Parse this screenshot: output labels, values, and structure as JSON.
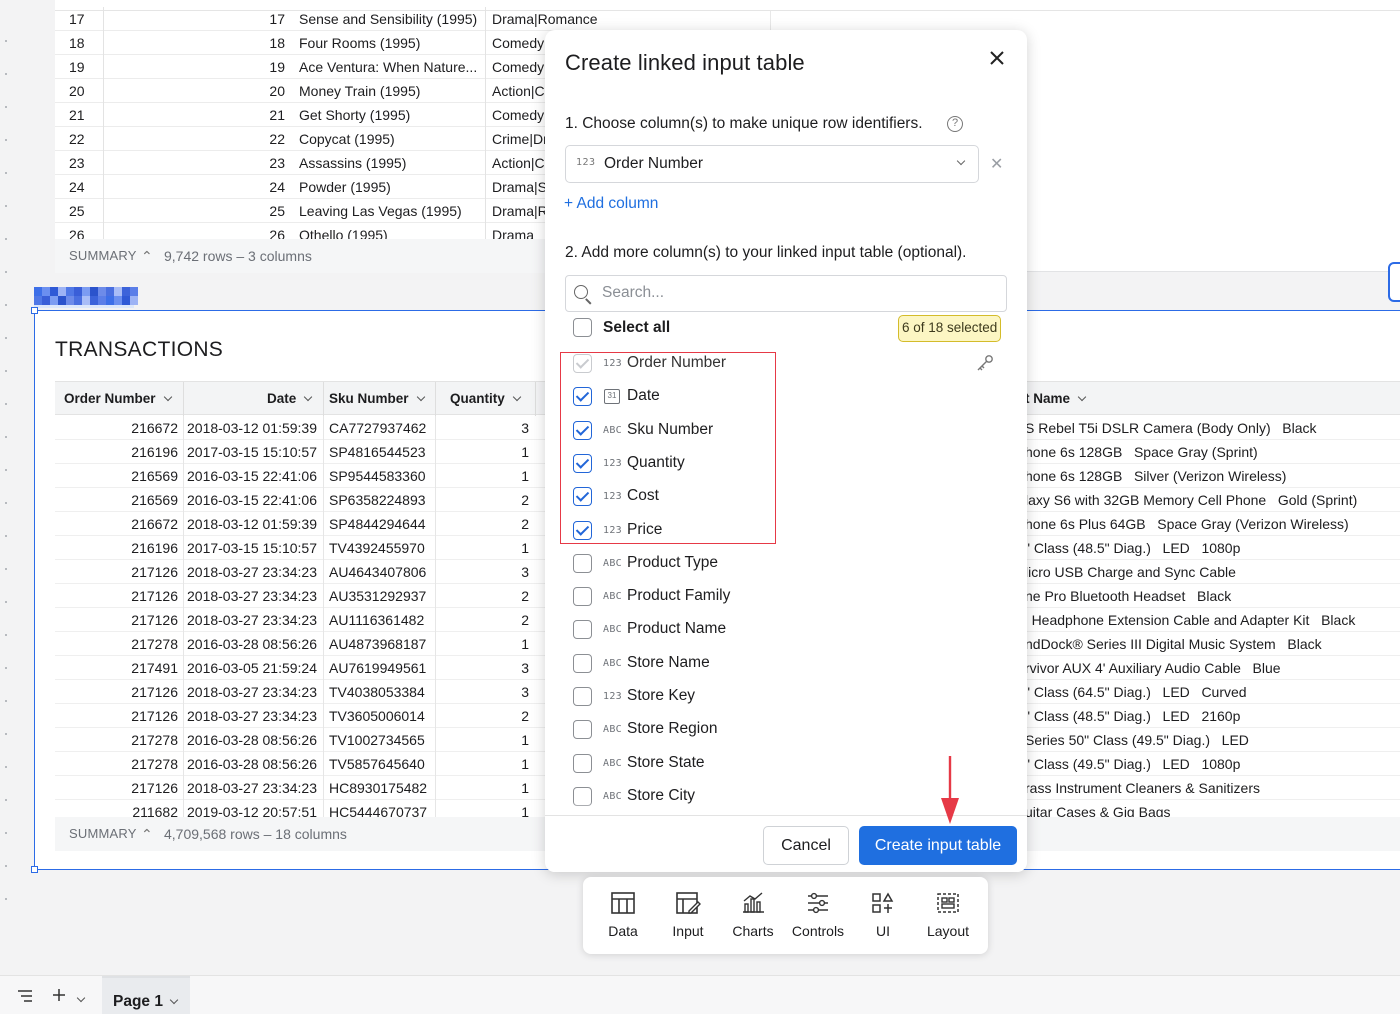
{
  "movies": {
    "rows": [
      {
        "idx": "17",
        "num": "17",
        "title": "Sense and Sensibility (1995)",
        "genre": "Drama|Romance"
      },
      {
        "idx": "18",
        "num": "18",
        "title": "Four Rooms (1995)",
        "genre": "Comedy"
      },
      {
        "idx": "19",
        "num": "19",
        "title": "Ace Ventura: When Nature...",
        "genre": "Comedy"
      },
      {
        "idx": "20",
        "num": "20",
        "title": "Money Train (1995)",
        "genre": "Action|C"
      },
      {
        "idx": "21",
        "num": "21",
        "title": "Get Shorty (1995)",
        "genre": "Comedy"
      },
      {
        "idx": "22",
        "num": "22",
        "title": "Copycat (1995)",
        "genre": "Crime|Dr"
      },
      {
        "idx": "23",
        "num": "23",
        "title": "Assassins (1995)",
        "genre": "Action|C"
      },
      {
        "idx": "24",
        "num": "24",
        "title": "Powder (1995)",
        "genre": "Drama|S"
      },
      {
        "idx": "25",
        "num": "25",
        "title": "Leaving Las Vegas (1995)",
        "genre": "Drama|R"
      },
      {
        "idx": "26",
        "num": "26",
        "title": "Othello (1995)",
        "genre": "Drama"
      }
    ],
    "summary_label": "SUMMARY",
    "summary_text": "9,742 rows – 3 columns"
  },
  "transactions": {
    "title": "TRANSACTIONS",
    "headers": {
      "order": "Order Number",
      "date": "Date",
      "sku": "Sku Number",
      "qty": "Quantity",
      "name": "t Name"
    },
    "rows": [
      {
        "order": "216672",
        "date": "2018-03-12 01:59:39",
        "sku": "CA7727937462",
        "qty": "3",
        "name": "S Rebel T5i DSLR Camera (Body Only)   Black"
      },
      {
        "order": "216196",
        "date": "2017-03-15 15:10:57",
        "sku": "SP4816544523",
        "qty": "1",
        "name": "hone 6s 128GB   Space Gray (Sprint)"
      },
      {
        "order": "216569",
        "date": "2016-03-15 22:41:06",
        "sku": "SP9544583360",
        "qty": "1",
        "name": "hone 6s 128GB   Silver (Verizon Wireless)"
      },
      {
        "order": "216569",
        "date": "2016-03-15 22:41:06",
        "sku": "SP6358224893",
        "qty": "2",
        "name": "laxy S6 with 32GB Memory Cell Phone   Gold (Sprint)"
      },
      {
        "order": "216672",
        "date": "2018-03-12 01:59:39",
        "sku": "SP4844294644",
        "qty": "2",
        "name": "hone 6s Plus 64GB   Space Gray (Verizon Wireless)"
      },
      {
        "order": "216196",
        "date": "2017-03-15 15:10:57",
        "sku": "TV4392455970",
        "qty": "1",
        "name": "\" Class (48.5\" Diag.)   LED   1080p"
      },
      {
        "order": "217126",
        "date": "2018-03-27 23:34:23",
        "sku": "AU4643407806",
        "qty": "3",
        "name": "licro USB Charge and Sync Cable"
      },
      {
        "order": "217126",
        "date": "2018-03-27 23:34:23",
        "sku": "AU3531292937",
        "qty": "2",
        "name": "ne Pro Bluetooth Headset   Black"
      },
      {
        "order": "217126",
        "date": "2018-03-27 23:34:23",
        "sku": "AU1116361482",
        "qty": "2",
        "name": "' Headphone Extension Cable and Adapter Kit   Black"
      },
      {
        "order": "217278",
        "date": "2016-03-28 08:56:26",
        "sku": "AU4873968187",
        "qty": "1",
        "name": "ndDock® Series III Digital Music System   Black"
      },
      {
        "order": "217491",
        "date": "2016-03-05 21:59:24",
        "sku": "AU7619949561",
        "qty": "3",
        "name": "rvivor AUX 4' Auxiliary Audio Cable   Blue"
      },
      {
        "order": "217126",
        "date": "2018-03-27 23:34:23",
        "sku": "TV4038053384",
        "qty": "3",
        "name": "\" Class (64.5\" Diag.)   LED   Curved"
      },
      {
        "order": "217126",
        "date": "2018-03-27 23:34:23",
        "sku": "TV3605006014",
        "qty": "2",
        "name": "\" Class (48.5\" Diag.)   LED   2160p"
      },
      {
        "order": "217278",
        "date": "2016-03-28 08:56:26",
        "sku": "TV1002734565",
        "qty": "1",
        "name": "Series 50\" Class (49.5\" Diag.)   LED"
      },
      {
        "order": "217278",
        "date": "2016-03-28 08:56:26",
        "sku": "TV5857645640",
        "qty": "1",
        "name": "\" Class (49.5\" Diag.)   LED   1080p"
      },
      {
        "order": "217126",
        "date": "2018-03-27 23:34:23",
        "sku": "HC8930175482",
        "qty": "1",
        "name": "rass Instrument Cleaners & Sanitizers"
      },
      {
        "order": "211682",
        "date": "2019-03-12 20:57:51",
        "sku": "HC5444670737",
        "qty": "1",
        "name": "uitar Cases & Gig Bags"
      }
    ],
    "summary_label": "SUMMARY",
    "summary_text": "4,709,568 rows – 18 columns"
  },
  "modal": {
    "title": "Create linked input table",
    "step1": "1. Choose column(s) to make unique row identifiers.",
    "help": "?",
    "identifier": {
      "type": "123",
      "value": "Order Number"
    },
    "add_column": "+ Add column",
    "step2": "2. Add more column(s) to your linked input table (optional).",
    "search_placeholder": "Search...",
    "select_all": "Select all",
    "selected_badge": "6 of 18 selected",
    "columns": [
      {
        "type": "123",
        "label": "Order Number",
        "state": "disabled"
      },
      {
        "type": "31",
        "label": "Date",
        "state": "checked",
        "icon": "calendar-icon"
      },
      {
        "type": "ABC",
        "label": "Sku Number",
        "state": "checked"
      },
      {
        "type": "123",
        "label": "Quantity",
        "state": "checked"
      },
      {
        "type": "123",
        "label": "Cost",
        "state": "checked"
      },
      {
        "type": "123",
        "label": "Price",
        "state": "checked"
      },
      {
        "type": "ABC",
        "label": "Product Type",
        "state": "unchecked"
      },
      {
        "type": "ABC",
        "label": "Product Family",
        "state": "unchecked"
      },
      {
        "type": "ABC",
        "label": "Product Name",
        "state": "unchecked"
      },
      {
        "type": "ABC",
        "label": "Store Name",
        "state": "unchecked"
      },
      {
        "type": "123",
        "label": "Store Key",
        "state": "unchecked"
      },
      {
        "type": "ABC",
        "label": "Store Region",
        "state": "unchecked"
      },
      {
        "type": "ABC",
        "label": "Store State",
        "state": "unchecked"
      },
      {
        "type": "ABC",
        "label": "Store City",
        "state": "unchecked"
      }
    ],
    "cancel": "Cancel",
    "create": "Create input table"
  },
  "toolbar": {
    "items": [
      {
        "label": "Data",
        "icon": "table-icon"
      },
      {
        "label": "Input",
        "icon": "input-table-icon"
      },
      {
        "label": "Charts",
        "icon": "chart-icon"
      },
      {
        "label": "Controls",
        "icon": "sliders-icon"
      },
      {
        "label": "UI",
        "icon": "shapes-icon"
      },
      {
        "label": "Layout",
        "icon": "layout-icon"
      }
    ]
  },
  "pagebar": {
    "page_label": "Page 1"
  },
  "colors": {
    "accent": "#1f6fe0",
    "highlight_box": "#e63946",
    "badge_bg": "#fcf6c3",
    "badge_border": "#d4bc2a"
  }
}
